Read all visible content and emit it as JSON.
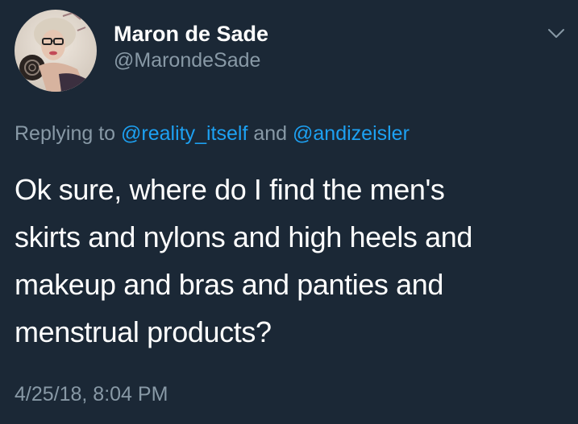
{
  "author": {
    "display_name": "Maron de Sade",
    "handle": "@MarondeSade",
    "avatar_icon": "profile-photo"
  },
  "reply": {
    "prefix": "Replying to ",
    "mention_1": "@reality_itself",
    "conjunction": " and ",
    "mention_2": "@andizeisler"
  },
  "tweet": {
    "lines": [
      "Ok sure, where do I find the men's",
      "skirts and nylons and high heels and",
      "makeup and bras and panties and",
      "menstrual products?"
    ],
    "timestamp": "4/25/18, 8:04 PM"
  },
  "menu": {
    "icon": "chevron-down-icon"
  },
  "colors": {
    "background": "#1b2836",
    "text_primary": "#ffffff",
    "text_secondary": "#8899a6",
    "link": "#1da1f2"
  }
}
